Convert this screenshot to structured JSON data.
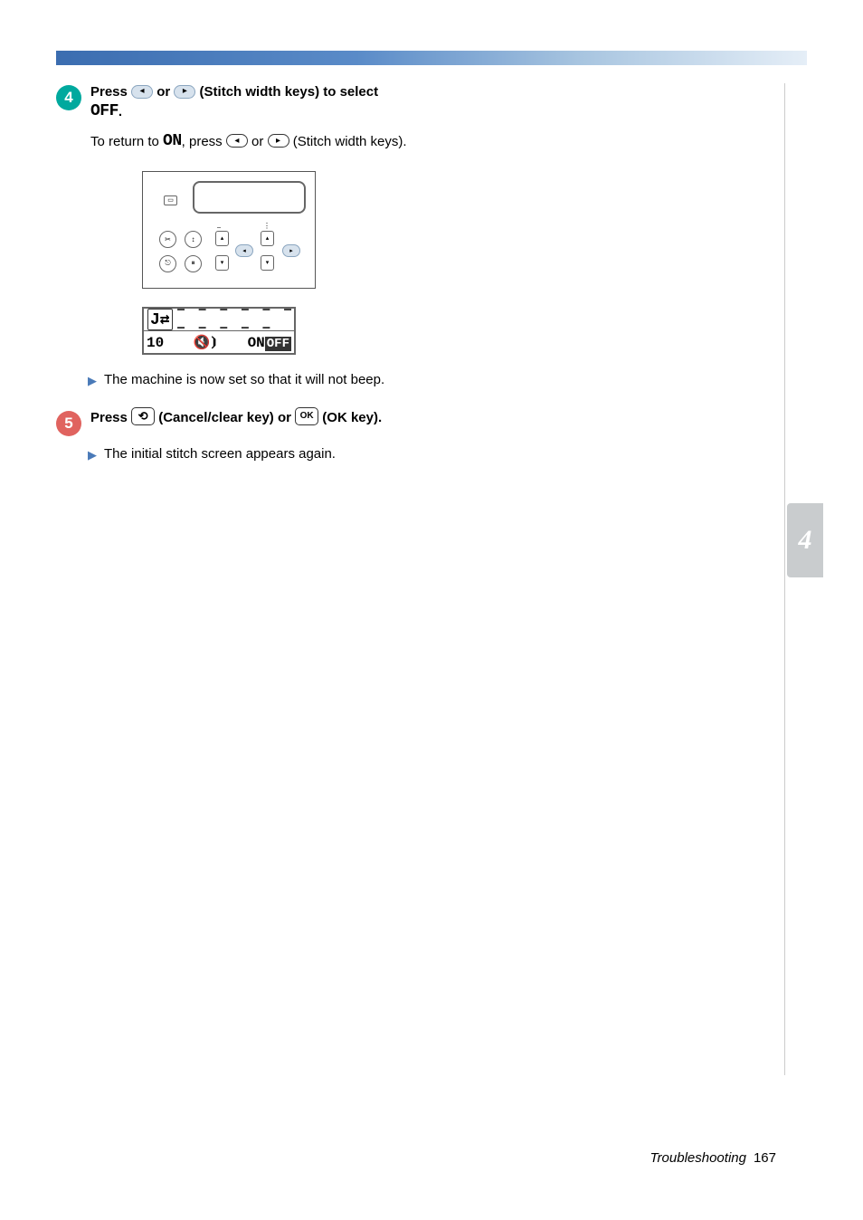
{
  "step4": {
    "number": "4",
    "line1_prefix": "Press ",
    "line1_mid": " or ",
    "line1_suffix": " (Stitch width keys) to select ",
    "off_label": "OFF",
    "period": ".",
    "return_prefix": "To return to ",
    "on_label": "ON",
    "return_mid1": ", press ",
    "return_mid2": " or ",
    "return_suffix": " (Stitch width keys)."
  },
  "lcd": {
    "dashes": "– – – – – – – – – – –",
    "bottom_left": "10",
    "speaker": "🔇",
    "on_text": "ON",
    "off_text": "OFF"
  },
  "bullet4": "The machine is now set so that it will not beep.",
  "step5": {
    "number": "5",
    "prefix": "Press ",
    "mid1": " (Cancel/clear key) or ",
    "ok_label": "OK",
    "suffix": " (OK key)."
  },
  "bullet5": "The initial stitch screen appears again.",
  "side_tab": "4",
  "footer": {
    "text": "Troubleshooting",
    "page": "167"
  }
}
